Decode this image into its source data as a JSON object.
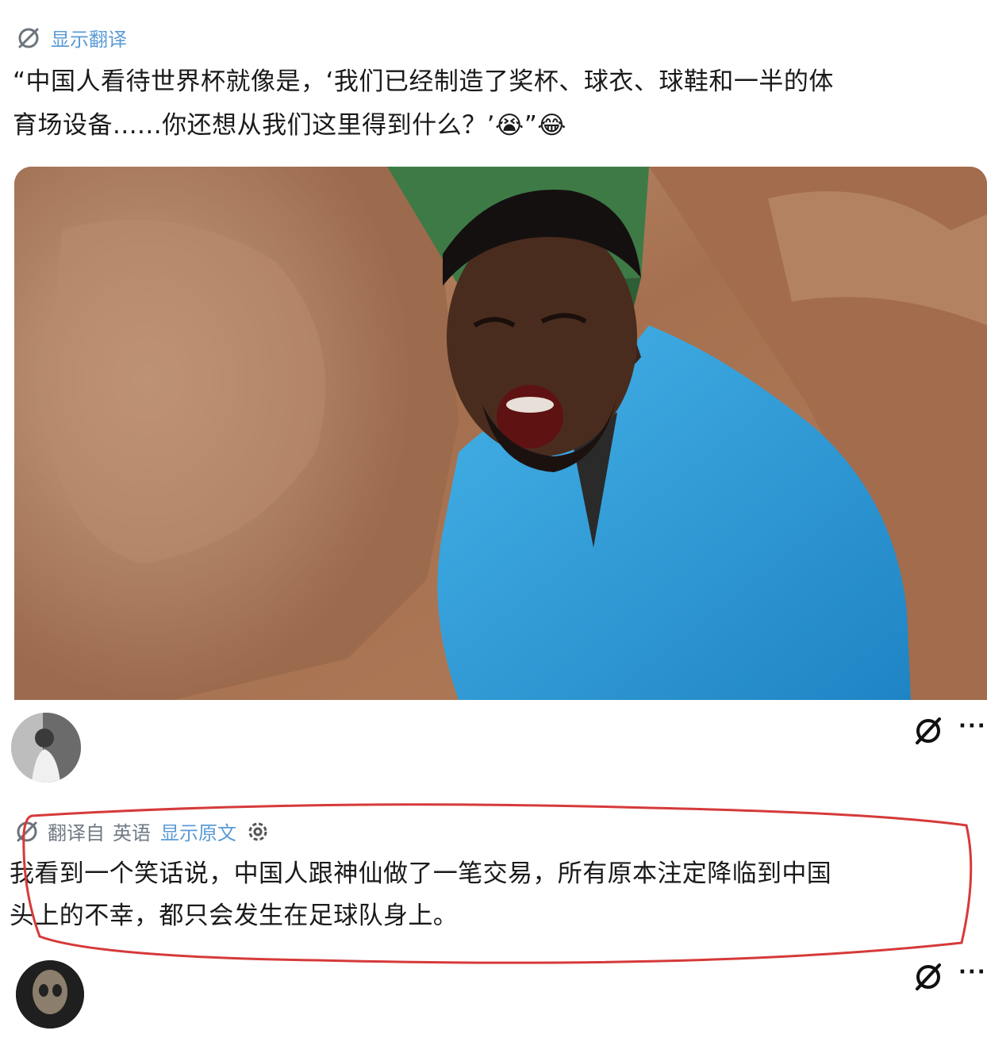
{
  "post": {
    "show_translation": "显示翻译",
    "text_line1": "“中国人看待世界杯就像是，‘我们已经制造了奖杯、球衣、球鞋和一半的体",
    "text_line2": "育场设备......你还想从我们这里得到什么？’",
    "emoji_1": "😭",
    "text_quote_close": "”",
    "emoji_2": "😂"
  },
  "reply_1": {
    "translated_from": "翻译自",
    "language": "英语",
    "show_original": "显示原文",
    "text_line1": "我看到一个笑话说，中国人跟神仙做了一笔交易，所有原本注定降临到中国",
    "text_line2": "头上的不幸，都只会发生在足球队身上。"
  },
  "more_label": "···",
  "icons": {
    "translate": "translate-icon",
    "more": "more-dots-icon",
    "settings": "gear-icon"
  },
  "colors": {
    "link": "#5b9bd5",
    "annotation": "#d63a3a",
    "shirt": "#2f9ad6"
  }
}
